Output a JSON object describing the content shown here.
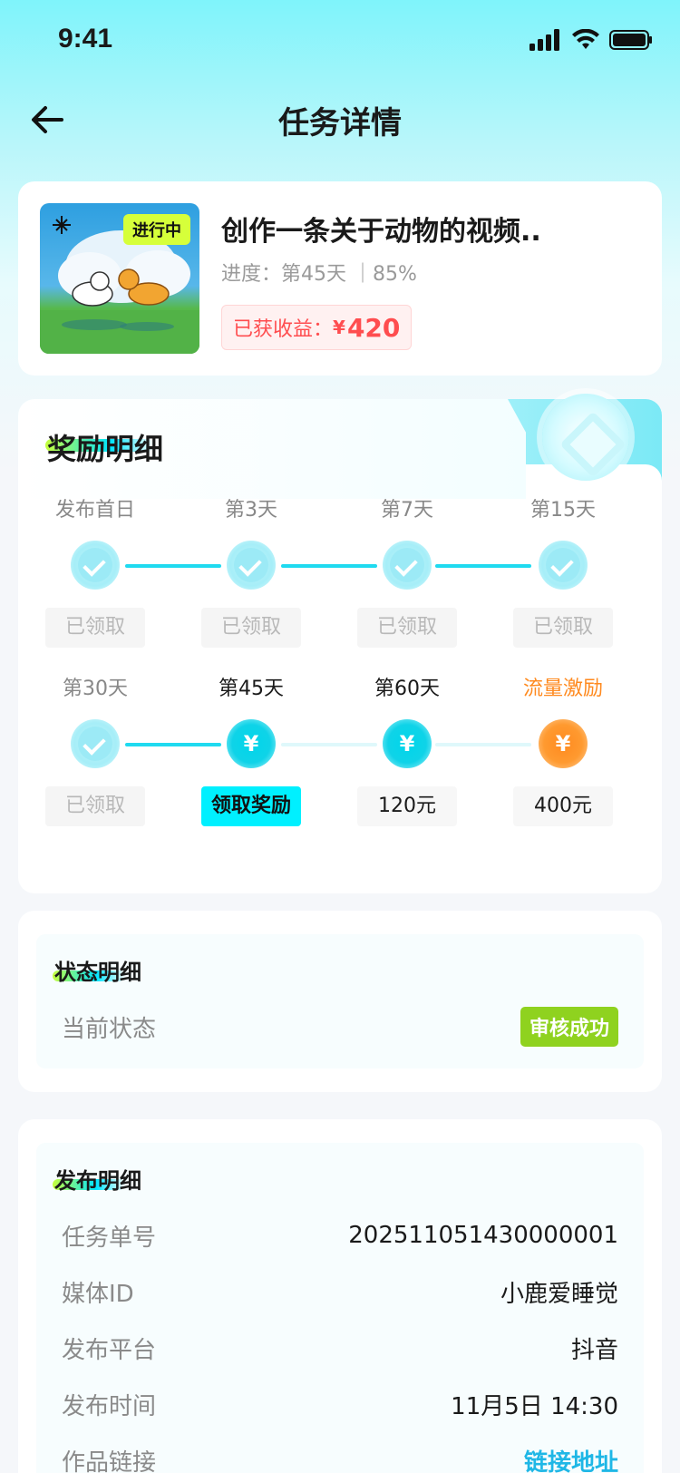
{
  "status_bar": {
    "time": "9:41"
  },
  "nav": {
    "title": "任务详情"
  },
  "task": {
    "thumbnail_badge": "进行中",
    "title": "创作一条关于动物的视频..",
    "progress": "进度：第45天 ｜85%",
    "earnings_label": "已获收益：",
    "earnings_currency": "¥",
    "earnings_amount": "420"
  },
  "reward": {
    "title": "奖励明细",
    "rows": [
      [
        {
          "label": "发布首日",
          "state": "done",
          "button": "已领取"
        },
        {
          "label": "第3天",
          "state": "done",
          "button": "已领取"
        },
        {
          "label": "第7天",
          "state": "done",
          "button": "已领取"
        },
        {
          "label": "第15天",
          "state": "done",
          "button": "已领取"
        }
      ],
      [
        {
          "label": "第30天",
          "state": "done",
          "button": "已领取"
        },
        {
          "label": "第45天",
          "state": "claimable",
          "button": "领取奖励",
          "icon": "¥"
        },
        {
          "label": "第60天",
          "state": "pending",
          "button": "120元",
          "icon": "¥"
        },
        {
          "label": "流量激励",
          "state": "bonus",
          "button": "400元",
          "icon": "¥"
        }
      ]
    ]
  },
  "status_section": {
    "title": "状态明细",
    "current_status_label": "当前状态",
    "current_status_value": "审核成功"
  },
  "publish_section": {
    "title": "发布明细",
    "rows": [
      {
        "key": "任务单号",
        "value": "202511051430000001"
      },
      {
        "key": "媒体ID",
        "value": "小鹿爱睡觉"
      },
      {
        "key": "发布平台",
        "value": "抖音"
      },
      {
        "key": "发布时间",
        "value": "11月5日 14:30"
      },
      {
        "key": "作品链接",
        "value": "链接地址"
      }
    ]
  },
  "colors": {
    "accent": "#00f0ff",
    "earnings": "#ff4d4f",
    "bonus": "#ff8a1f",
    "success_badge": "#8fd21f",
    "link": "#1fb7e6"
  }
}
